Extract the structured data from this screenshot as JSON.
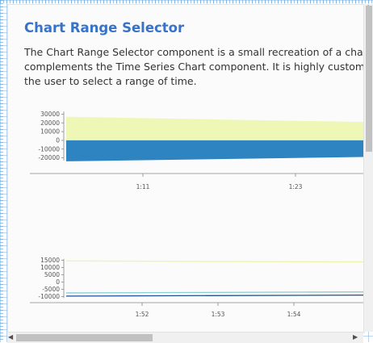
{
  "page": {
    "title": "Chart Range Selector",
    "description": "The Chart Range Selector component is a small recreation of a chart that often complements the Time Series Chart component. It is highly customizeable and allows the user to select a range of time.",
    "colors": {
      "title": "#3773c9",
      "text": "#333333",
      "panel": "#fbfbfc"
    }
  },
  "chart_data": [
    {
      "type": "area",
      "title": "",
      "y_ticks": [
        "30000",
        "20000",
        "10000",
        "0",
        "-10000",
        "-20000"
      ],
      "x_ticks": [
        "1:11",
        "1:23"
      ],
      "ylim": [
        -25000,
        35000
      ],
      "series": [
        {
          "color": "#eef7b6",
          "x": [
            "1:05",
            "1:30"
          ],
          "values": [
            27000,
            21000
          ]
        },
        {
          "color": "#2d84c0",
          "x": [
            "1:05",
            "1:30"
          ],
          "values": [
            -24000,
            -19000
          ]
        }
      ]
    },
    {
      "type": "line",
      "title": "",
      "y_ticks": [
        "15000",
        "10000",
        "5000",
        "0",
        "-5000",
        "-10000"
      ],
      "x_ticks": [
        "1:52",
        "1:53",
        "1:54"
      ],
      "ylim": [
        -12000,
        17000
      ],
      "series": [
        {
          "color": "#eef4a8",
          "x": [
            "1:51",
            "1:55"
          ],
          "values": [
            14600,
            13900
          ]
        },
        {
          "color": "#8ccfd2",
          "x": [
            "1:51",
            "1:55"
          ],
          "values": [
            -7500,
            -6800
          ]
        },
        {
          "color": "#1f4f8f",
          "x": [
            "1:51",
            "1:55"
          ],
          "values": [
            -9700,
            -9000
          ]
        }
      ]
    }
  ],
  "scrollbars": {
    "left_arrow": "◀",
    "right_arrow": "▶",
    "up_arrow": "▲",
    "down_arrow": "▼"
  }
}
